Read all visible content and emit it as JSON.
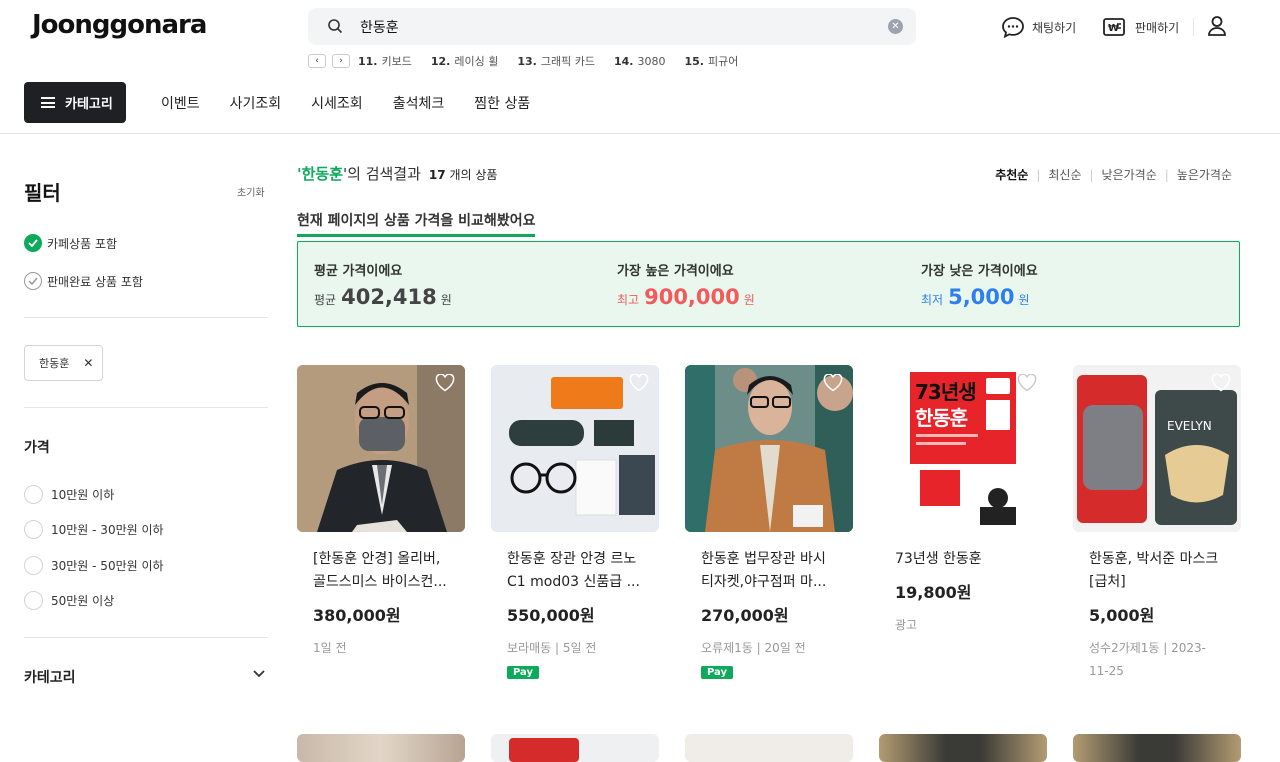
{
  "header": {
    "logo": "Joonggonara",
    "search_value": "한동훈",
    "trending": [
      {
        "rank": "11.",
        "word": "키보드"
      },
      {
        "rank": "12.",
        "word": "레이싱 휠"
      },
      {
        "rank": "13.",
        "word": "그래픽 카드"
      },
      {
        "rank": "14.",
        "word": "3080"
      },
      {
        "rank": "15.",
        "word": "피규어"
      }
    ],
    "chat_label": "채팅하기",
    "sell_label": "판매하기"
  },
  "nav": {
    "category_label": "카테고리",
    "links": [
      "이벤트",
      "사기조회",
      "시세조회",
      "출석체크",
      "찜한 상품"
    ]
  },
  "sidebar": {
    "filter_title": "필터",
    "reset_label": "초기화",
    "include_cafe": "카페상품 포함",
    "include_sold": "판매완료 상품 포함",
    "chip_label": "한동훈",
    "price_title": "가격",
    "price_options": [
      "10만원 이하",
      "10만원 - 30만원 이하",
      "30만원 - 50만원 이하",
      "50만원 이상"
    ],
    "category_title": "카테고리"
  },
  "results": {
    "query": "한동훈",
    "quote_open": "'",
    "quote_close": "'의 검색결과",
    "count": "17",
    "count_suffix": "개의 상품",
    "sorts": [
      "추천순",
      "최신순",
      "낮은가격순",
      "높은가격순"
    ]
  },
  "compare": {
    "title": "현재 페이지의 상품 가격을 비교해봤어요",
    "avg_title": "평균 가격이에요",
    "avg_prefix": "평균",
    "avg_value": "402,418",
    "high_title": "가장 높은 가격이에요",
    "high_prefix": "최고",
    "high_value": "900,000",
    "low_title": "가장 낮은 가격이에요",
    "low_prefix": "최저",
    "low_value": "5,000",
    "won": "원",
    "colors": {
      "high": "#f05b5b",
      "low": "#2f80ed",
      "accent": "#0daa5b"
    }
  },
  "products": [
    {
      "name": "[한동훈 안경] 올리버, 골드스미스 바이스컨...",
      "price": "380,000원",
      "meta": "1일 전",
      "pay": ""
    },
    {
      "name": "한동훈 장관 안경 르노 C1 mod03 신품급 ...",
      "price": "550,000원",
      "meta": "보라매동 | 5일 전",
      "pay": "Pay"
    },
    {
      "name": "한동훈 법무장관 바시 티자켓,야구점퍼 마...",
      "price": "270,000원",
      "meta": "오류제1동 | 20일 전",
      "pay": "Pay"
    },
    {
      "name": "73년생 한동훈",
      "price": "19,800원",
      "meta": "광고",
      "pay": ""
    },
    {
      "name": "한동훈, 박서준 마스크 [급처]",
      "price": "5,000원",
      "meta": "성수2가제1동 | 2023-11-25",
      "pay": ""
    }
  ],
  "book_cover": {
    "line1": "73년생",
    "line2": "한동훈"
  },
  "mask_brand": "EVELYN"
}
